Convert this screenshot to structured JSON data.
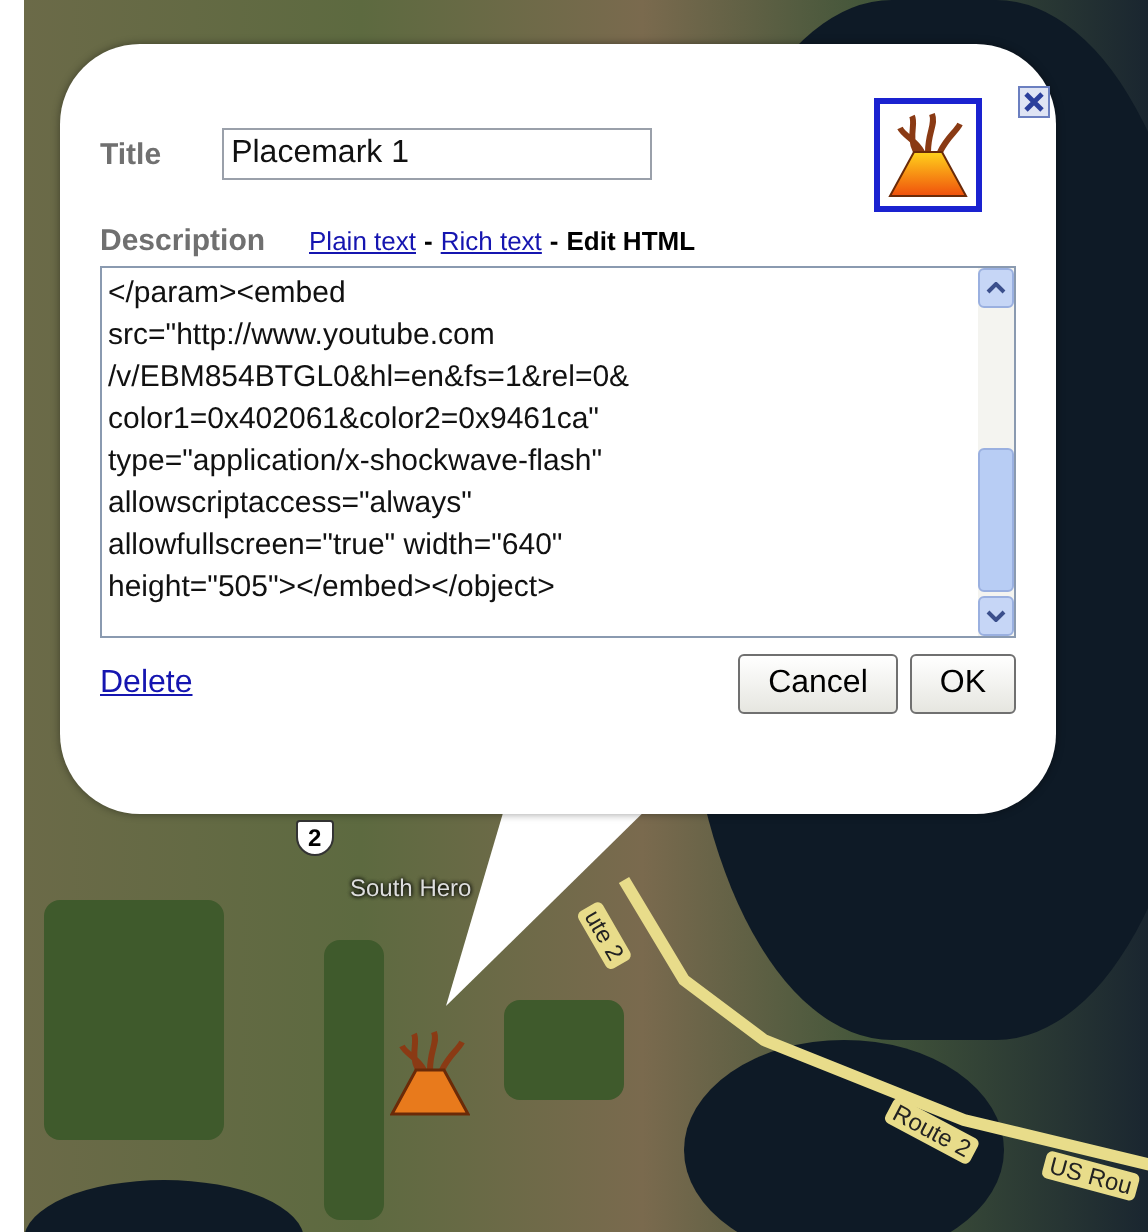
{
  "map": {
    "labels": [
      {
        "text": "2",
        "kind": "shield"
      },
      {
        "text": "South Hero",
        "kind": "place"
      },
      {
        "text": "ute 2",
        "kind": "road"
      },
      {
        "text": "Route 2",
        "kind": "road"
      },
      {
        "text": "US Rou",
        "kind": "road"
      }
    ]
  },
  "balloon": {
    "title_label": "Title",
    "title_value": "Placemark 1",
    "description_label": "Description",
    "modes": [
      {
        "label": "Plain text",
        "selected": false
      },
      {
        "label": "Rich text",
        "selected": false
      },
      {
        "label": "Edit HTML",
        "selected": true
      }
    ],
    "separator": "-",
    "html_lines": [
      "</param><embed",
      "src=\"http://www.youtube.com",
      "/v/EBM854BTGL0&hl=en&fs=1&rel=0&",
      "color1=0x402061&color2=0x9461ca\"",
      "type=\"application/x-shockwave-flash\"",
      "allowscriptaccess=\"always\"",
      "allowfullscreen=\"true\" width=\"640\"",
      "height=\"505\"></embed></object>"
    ],
    "delete_link": "Delete",
    "buttons": [
      "Cancel",
      "OK"
    ]
  }
}
